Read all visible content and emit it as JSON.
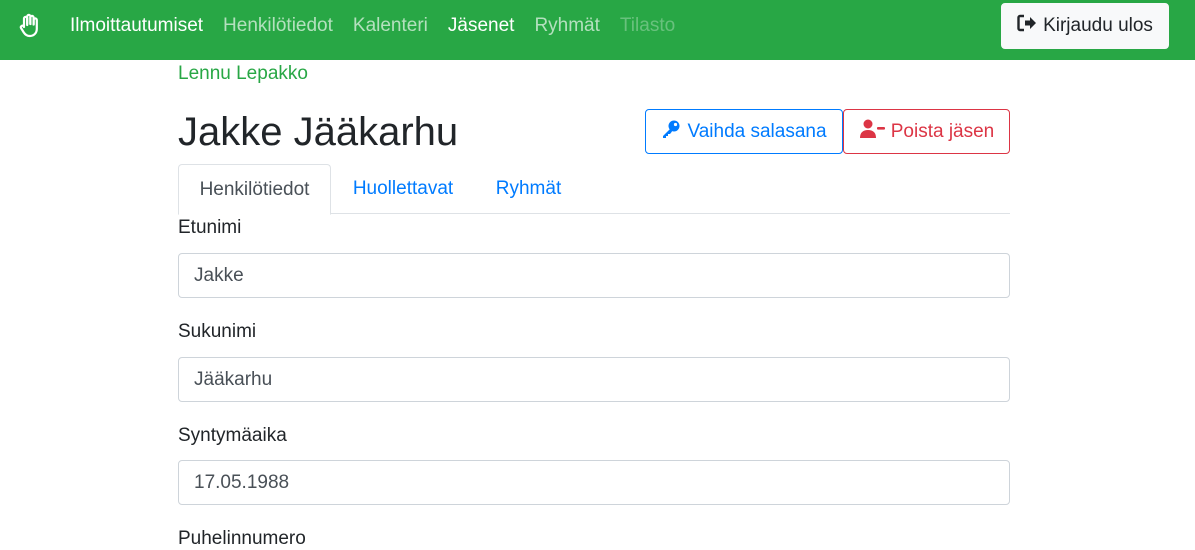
{
  "navbar": {
    "brand_icon": "hand-icon",
    "links": [
      {
        "label": "Ilmoittautumiset"
      },
      {
        "label": "Henkilötiedot"
      },
      {
        "label": "Kalenteri"
      },
      {
        "label": "Jäsenet"
      },
      {
        "label": "Ryhmät"
      },
      {
        "label": "Tilasto"
      }
    ],
    "logout_label": "Kirjaudu ulos",
    "color": "#28a745"
  },
  "breadcrumb": {
    "link": "Lennu Lepakko"
  },
  "page": {
    "title": "Jakke Jääkarhu",
    "change_password_label": "Vaihda salasana",
    "delete_member_label": "Poista jäsen"
  },
  "tabs": [
    {
      "label": "Henkilötiedot",
      "active": true
    },
    {
      "label": "Huollettavat",
      "active": false
    },
    {
      "label": "Ryhmät",
      "active": false
    }
  ],
  "form": {
    "first_name": {
      "label": "Etunimi",
      "value": "Jakke"
    },
    "last_name": {
      "label": "Sukunimi",
      "value": "Jääkarhu"
    },
    "birthdate": {
      "label": "Syntymäaika",
      "value": "17.05.1988"
    },
    "phone": {
      "label": "Puhelinnumero"
    }
  },
  "colors": {
    "primary": "#007bff",
    "danger": "#dc3545",
    "success": "#28a745"
  }
}
